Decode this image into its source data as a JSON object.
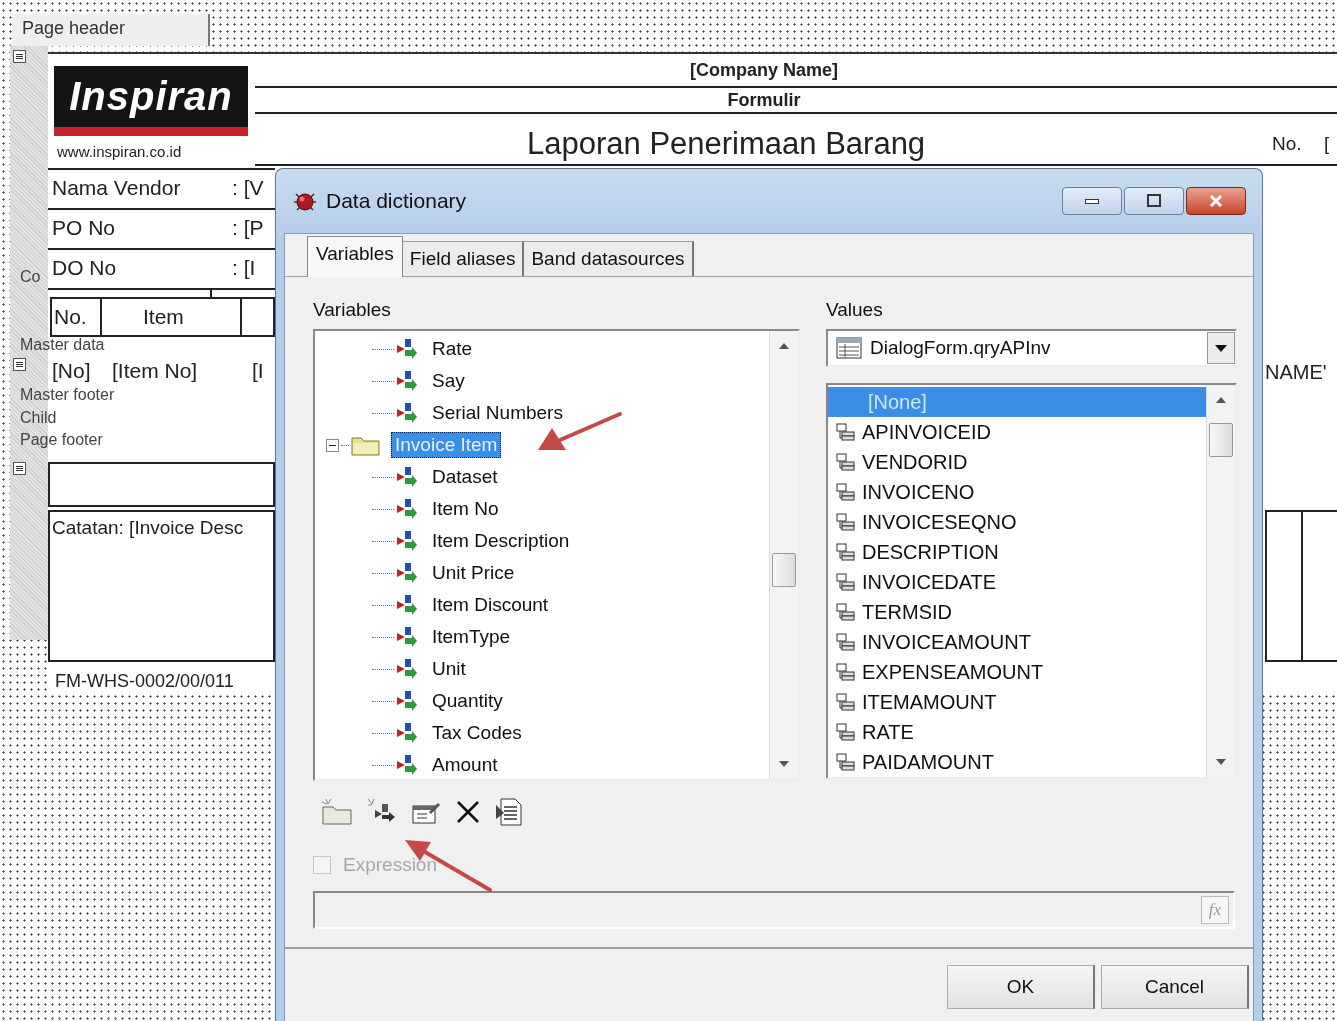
{
  "designer": {
    "bands": [
      {
        "label": "Page header",
        "kind": "header"
      },
      {
        "label": "Co",
        "kind": "band"
      },
      {
        "label": "Master data",
        "kind": "band"
      },
      {
        "label": "Master footer",
        "kind": "band"
      },
      {
        "label": "Child",
        "kind": "band"
      },
      {
        "label": "Page footer",
        "kind": "band"
      }
    ],
    "logo": {
      "text": "Inspiran",
      "website": "www.inspiran.co.id"
    },
    "company": "[Company Name]",
    "form": "Formulir",
    "title": "Laporan Penerimaan Barang",
    "number_label": "No.",
    "number_value": "[",
    "fields": [
      {
        "label": "Nama Vendor",
        "value": ": [V"
      },
      {
        "label": "PO No",
        "value": ": [P"
      },
      {
        "label": "DO No",
        "value": ": [I"
      }
    ],
    "table_header": [
      "No.",
      "Item"
    ],
    "detail_row": [
      "[No]",
      "[Item No]",
      "[I"
    ],
    "right_field": "NAME'",
    "note": "Catatan: [Invoice Desc",
    "form_code": "FM-WHS-0002/00/011"
  },
  "dialog": {
    "title": "Data dictionary",
    "tabs": [
      {
        "label": "Variables",
        "selected": true
      },
      {
        "label": "Field aliases",
        "selected": false
      },
      {
        "label": "Band datasources",
        "selected": false
      }
    ],
    "variables_label": "Variables",
    "tree": [
      {
        "label": "Rate",
        "kind": "variable",
        "selected": false
      },
      {
        "label": "Say",
        "kind": "variable",
        "selected": false
      },
      {
        "label": "Serial Numbers",
        "kind": "variable",
        "selected": false
      },
      {
        "label": "Invoice Item",
        "kind": "folder",
        "selected": true,
        "expanded": true,
        "children": [
          {
            "label": "Dataset",
            "kind": "variable",
            "selected": false
          },
          {
            "label": "Item No",
            "kind": "variable",
            "selected": false
          },
          {
            "label": "Item Description",
            "kind": "variable",
            "selected": false
          },
          {
            "label": "Unit Price",
            "kind": "variable",
            "selected": false
          },
          {
            "label": "Item Discount",
            "kind": "variable",
            "selected": false
          },
          {
            "label": "ItemType",
            "kind": "variable",
            "selected": false
          },
          {
            "label": "Unit",
            "kind": "variable",
            "selected": false
          },
          {
            "label": "Quantity",
            "kind": "variable",
            "selected": false
          },
          {
            "label": "Tax Codes",
            "kind": "variable",
            "selected": false
          },
          {
            "label": "Amount",
            "kind": "variable",
            "selected": false
          }
        ]
      }
    ],
    "values_label": "Values",
    "datasource": "DialogForm.qryAPInv",
    "values": [
      {
        "label": "[None]",
        "kind": "none",
        "selected": true
      },
      {
        "label": "APINVOICEID",
        "kind": "field",
        "selected": false
      },
      {
        "label": "VENDORID",
        "kind": "field",
        "selected": false
      },
      {
        "label": "INVOICENO",
        "kind": "field",
        "selected": false
      },
      {
        "label": "INVOICESEQNO",
        "kind": "field",
        "selected": false
      },
      {
        "label": "DESCRIPTION",
        "kind": "field",
        "selected": false
      },
      {
        "label": "INVOICEDATE",
        "kind": "field",
        "selected": false
      },
      {
        "label": "TERMSID",
        "kind": "field",
        "selected": false
      },
      {
        "label": "INVOICEAMOUNT",
        "kind": "field",
        "selected": false
      },
      {
        "label": "EXPENSEAMOUNT",
        "kind": "field",
        "selected": false
      },
      {
        "label": "ITEMAMOUNT",
        "kind": "field",
        "selected": false
      },
      {
        "label": "RATE",
        "kind": "field",
        "selected": false
      },
      {
        "label": "PAIDAMOUNT",
        "kind": "field",
        "selected": false
      }
    ],
    "expression": {
      "label": "Expression",
      "checked": false,
      "disabled": true
    },
    "formula_button": "fx",
    "buttons": [
      "OK",
      "Cancel"
    ]
  }
}
